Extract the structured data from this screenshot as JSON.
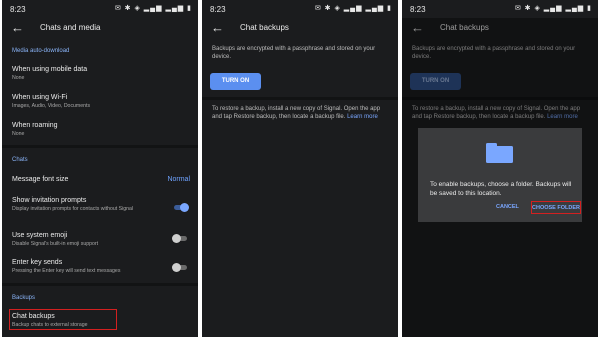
{
  "status_bar": {
    "time": "8:23",
    "icons_text": "✉ ✱ ◈ ▂▄▆ ▂▄▆ ▮"
  },
  "screen1": {
    "title": "Chats and media",
    "media_auto_download": {
      "section": "Media auto-download",
      "mobile_data": {
        "title": "When using mobile data",
        "sub": "None"
      },
      "wifi": {
        "title": "When using Wi-Fi",
        "sub": "Images, Audio, Video, Documents"
      },
      "roaming": {
        "title": "When roaming",
        "sub": "None"
      }
    },
    "chats": {
      "section": "Chats",
      "font_size": {
        "title": "Message font size",
        "value": "Normal"
      },
      "invitation": {
        "title": "Show invitation prompts",
        "sub": "Display invitation prompts for contacts without Signal",
        "on": true
      },
      "emoji": {
        "title": "Use system emoji",
        "sub": "Disable Signal's built-in emoji support",
        "on": false
      },
      "enter": {
        "title": "Enter key sends",
        "sub": "Pressing the Enter key will send text messages",
        "on": false
      }
    },
    "backups": {
      "section": "Backups",
      "chat_backups": {
        "title": "Chat backups",
        "sub": "Backup chats to external storage"
      }
    }
  },
  "screen2": {
    "title": "Chat backups",
    "description": "Backups are encrypted with a passphrase and stored on your device.",
    "turn_on": "TURN ON",
    "restore_text": "To restore a backup, install a new copy of Signal. Open the app and tap Restore backup, then locate a backup file.",
    "learn_more": "Learn more"
  },
  "screen3": {
    "title": "Chat backups",
    "description": "Backups are encrypted with a passphrase and stored on your device.",
    "turn_on": "TURN ON",
    "restore_text": "To restore a backup, install a new copy of Signal. Open the app and tap Restore backup, then locate a backup file.",
    "learn_more": "Learn more",
    "dialog": {
      "icon": "folder-icon",
      "message": "To enable backups, choose a folder. Backups will be saved to this location.",
      "cancel": "CANCEL",
      "choose": "CHOOSE FOLDER"
    }
  },
  "colors": {
    "background": "#1b1c1e",
    "accent": "#7aa7ff",
    "button": "#5b8ff0",
    "highlight": "#d32020",
    "dialog": "#3a3b3d"
  }
}
